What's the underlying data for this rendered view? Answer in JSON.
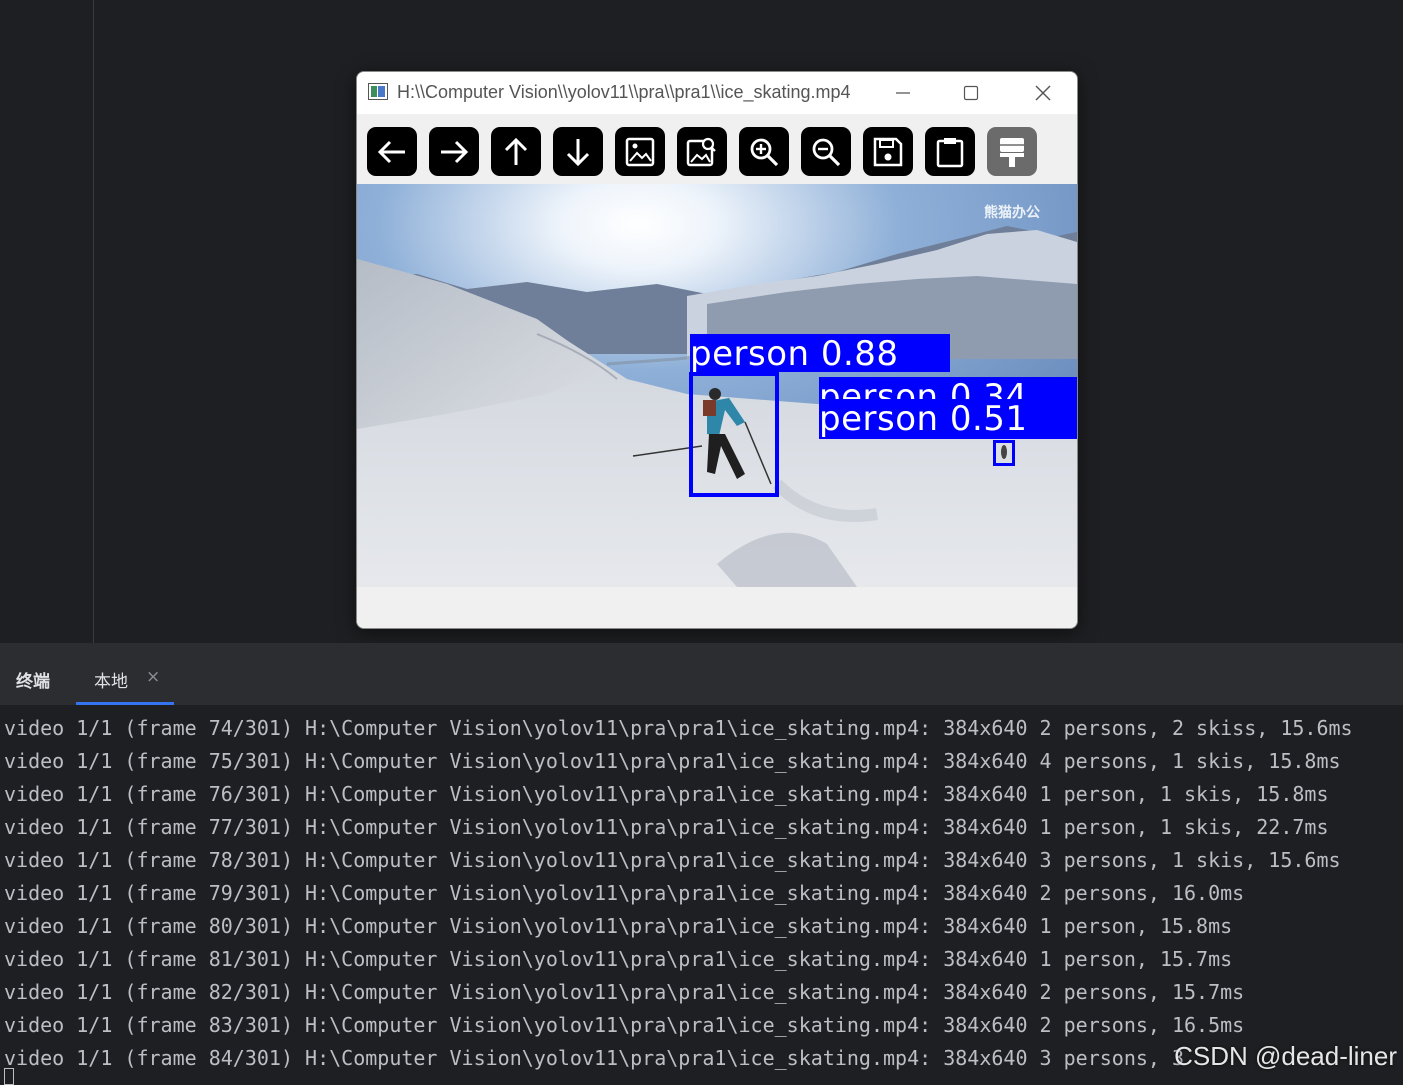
{
  "window": {
    "title": "H:\\\\Computer Vision\\\\yolov11\\\\pra\\\\pra1\\\\ice_skating.mp4"
  },
  "toolbar": {
    "icons": [
      "arrow-left-icon",
      "arrow-right-icon",
      "arrow-up-icon",
      "arrow-down-icon",
      "image-icon",
      "image-search-icon",
      "zoom-in-icon",
      "zoom-out-icon",
      "save-icon",
      "clipboard-icon",
      "properties-icon"
    ]
  },
  "video": {
    "watermark": "熊猫办公",
    "detections": [
      {
        "label": "person 0.88"
      },
      {
        "label": "person 0.34"
      },
      {
        "label": "person 0.51"
      }
    ],
    "box_color": "#0000ff"
  },
  "terminal": {
    "title": "终端",
    "tab_label": "本地",
    "tab_close": "×",
    "lines": [
      "video 1/1 (frame 74/301) H:\\Computer Vision\\yolov11\\pra\\pra1\\ice_skating.mp4: 384x640 2 persons, 2 skiss, 15.6ms",
      "video 1/1 (frame 75/301) H:\\Computer Vision\\yolov11\\pra\\pra1\\ice_skating.mp4: 384x640 4 persons, 1 skis, 15.8ms",
      "video 1/1 (frame 76/301) H:\\Computer Vision\\yolov11\\pra\\pra1\\ice_skating.mp4: 384x640 1 person, 1 skis, 15.8ms",
      "video 1/1 (frame 77/301) H:\\Computer Vision\\yolov11\\pra\\pra1\\ice_skating.mp4: 384x640 1 person, 1 skis, 22.7ms",
      "video 1/1 (frame 78/301) H:\\Computer Vision\\yolov11\\pra\\pra1\\ice_skating.mp4: 384x640 3 persons, 1 skis, 15.6ms",
      "video 1/1 (frame 79/301) H:\\Computer Vision\\yolov11\\pra\\pra1\\ice_skating.mp4: 384x640 2 persons, 16.0ms",
      "video 1/1 (frame 80/301) H:\\Computer Vision\\yolov11\\pra\\pra1\\ice_skating.mp4: 384x640 1 person, 15.8ms",
      "video 1/1 (frame 81/301) H:\\Computer Vision\\yolov11\\pra\\pra1\\ice_skating.mp4: 384x640 1 person, 15.7ms",
      "video 1/1 (frame 82/301) H:\\Computer Vision\\yolov11\\pra\\pra1\\ice_skating.mp4: 384x640 2 persons, 15.7ms",
      "video 1/1 (frame 83/301) H:\\Computer Vision\\yolov11\\pra\\pra1\\ice_skating.mp4: 384x640 2 persons, 16.5ms",
      "video 1/1 (frame 84/301) H:\\Computer Vision\\yolov11\\pra\\pra1\\ice_skating.mp4: 384x640 3 persons, 3"
    ]
  },
  "watermark": "CSDN @dead-liner"
}
